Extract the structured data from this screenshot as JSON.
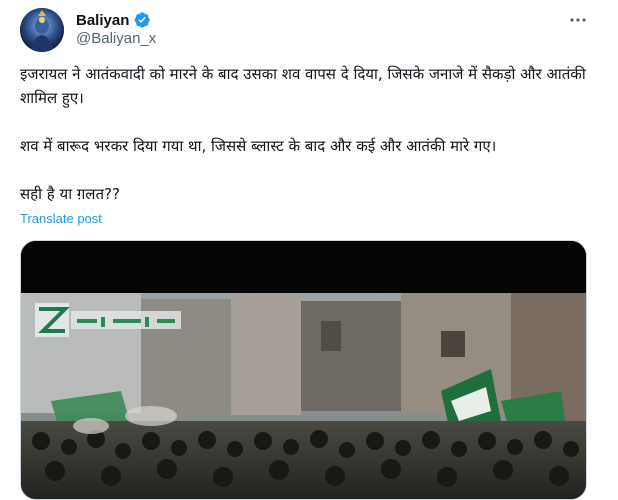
{
  "author": {
    "display_name": "Baliyan",
    "handle": "@Baliyan_x",
    "verified": true,
    "avatar_icon": "avatar-image"
  },
  "tweet": {
    "paragraphs": [
      "इजरायल ने आतंकवादी को मारने के बाद उसका शव वापस दे दिया, जिसके जनाजे में सैकड़ो और आतंकी शामिल हुए।",
      "शव में बारूद भरकर दिया गया था, जिससे ब्लास्ट के बाद और कई और आतंकी मारे गए।",
      "सही है या ग़लत??"
    ],
    "translate_label": "Translate post"
  },
  "media": {
    "type": "video",
    "watermark": "Z"
  },
  "icons": {
    "more": "more-options-icon",
    "verified": "verified-badge-icon"
  },
  "colors": {
    "text": "#0f1419",
    "secondary": "#536471",
    "link": "#1d9bf0",
    "verified": "#1d9bf0"
  }
}
